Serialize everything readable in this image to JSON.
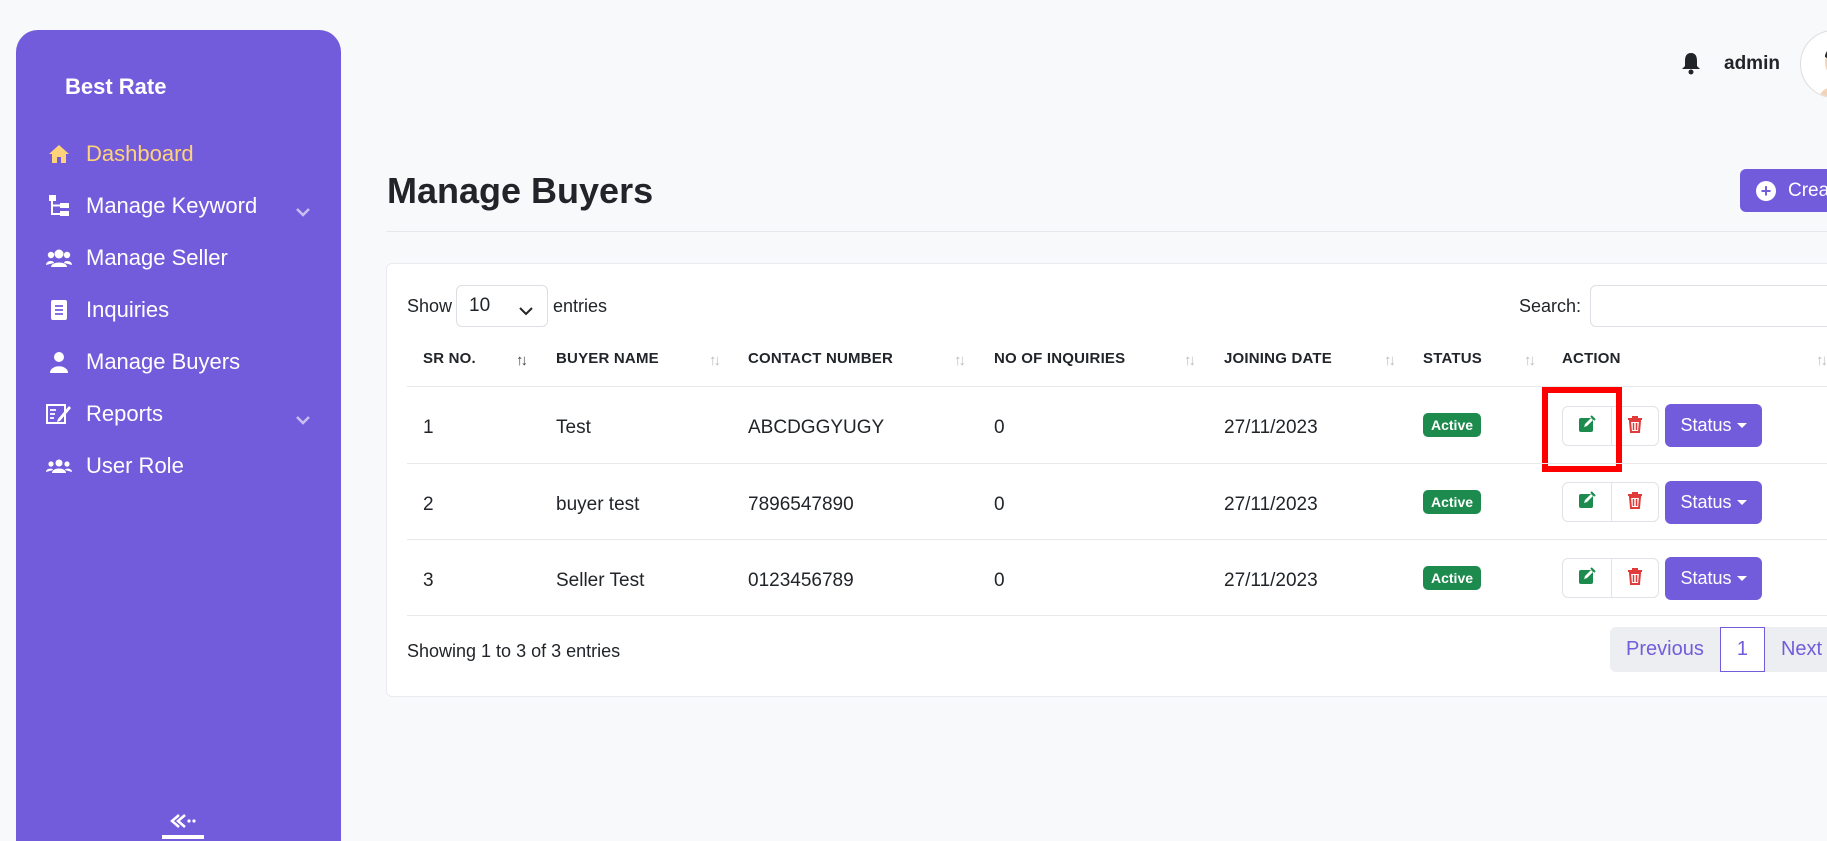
{
  "sidebar": {
    "brand": "Best Rate",
    "items": [
      {
        "label": "Dashboard",
        "icon": "home-icon"
      },
      {
        "label": "Manage Keyword",
        "icon": "sitemap-icon"
      },
      {
        "label": "Manage Seller",
        "icon": "users-icon"
      },
      {
        "label": "Inquiries",
        "icon": "document-icon"
      },
      {
        "label": "Manage Buyers",
        "icon": "user-icon"
      },
      {
        "label": "Reports",
        "icon": "report-icon"
      },
      {
        "label": "User Role",
        "icon": "user-group-icon"
      }
    ]
  },
  "header": {
    "user": "admin"
  },
  "page": {
    "title": "Manage Buyers",
    "create_label": "Create"
  },
  "table": {
    "show_label": "Show",
    "entries_value": "10",
    "entries_label": "entries",
    "search_label": "Search:",
    "columns": [
      "SR NO.",
      "BUYER NAME",
      "CONTACT NUMBER",
      "NO OF INQUIRIES",
      "JOINING DATE",
      "STATUS",
      "ACTION"
    ],
    "rows": [
      {
        "sr": "1",
        "name": "Test",
        "contact": "ABCDGGYUGY",
        "inquiries": "0",
        "date": "27/11/2023",
        "status": "Active"
      },
      {
        "sr": "2",
        "name": "buyer test",
        "contact": "7896547890",
        "inquiries": "0",
        "date": "27/11/2023",
        "status": "Active"
      },
      {
        "sr": "3",
        "name": "Seller Test",
        "contact": "0123456789",
        "inquiries": "0",
        "date": "27/11/2023",
        "status": "Active"
      }
    ],
    "status_button": "Status",
    "showing": "Showing 1 to 3 of 3 entries",
    "pagination": {
      "previous": "Previous",
      "page": "1",
      "next": "Next"
    }
  },
  "colors": {
    "accent": "#735cdb",
    "active_nav": "#ffd37a",
    "badge": "#1d8a4e",
    "delete": "#e03a3a",
    "edit": "#1d8a4e",
    "highlight": "#ff0000"
  }
}
